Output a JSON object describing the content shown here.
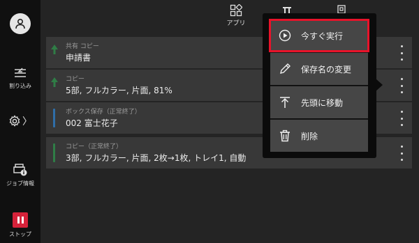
{
  "sidebar": {
    "interrupt_label": "割り込み",
    "job_info_label": "ジョブ情報",
    "stop_label": "ストップ",
    "settings_chevron": "〉"
  },
  "topbar": {
    "app_label": "アプリ"
  },
  "jobs": [
    {
      "tag": "共有 コピー",
      "desc": "申請書",
      "accent": "#2f7d46"
    },
    {
      "tag": "コピー",
      "desc": "5部, フルカラー, 片面, 81%",
      "accent": "#2f7d46"
    },
    {
      "tag": "ボックス保存（正常終了）",
      "desc": "002 富士花子",
      "accent": "#2f6ea8"
    },
    {
      "tag": "コピー（正常終了）",
      "desc": "3部, フルカラー, 片面, 2枚→1枚, トレイ1, 自動",
      "accent": "#2f7d46"
    }
  ],
  "menu": {
    "items": [
      {
        "label": "今すぐ実行",
        "icon": "play-circle-icon"
      },
      {
        "label": "保存名の変更",
        "icon": "pencil-icon"
      },
      {
        "label": "先頭に移動",
        "icon": "move-to-top-icon"
      },
      {
        "label": "削除",
        "icon": "trash-icon"
      }
    ],
    "highlight_color": "#e8132a"
  },
  "colors": {
    "background": "#242424",
    "sidebar": "#101010",
    "row": "#383838",
    "menu_item": "#464646",
    "stop": "#d6223a"
  }
}
